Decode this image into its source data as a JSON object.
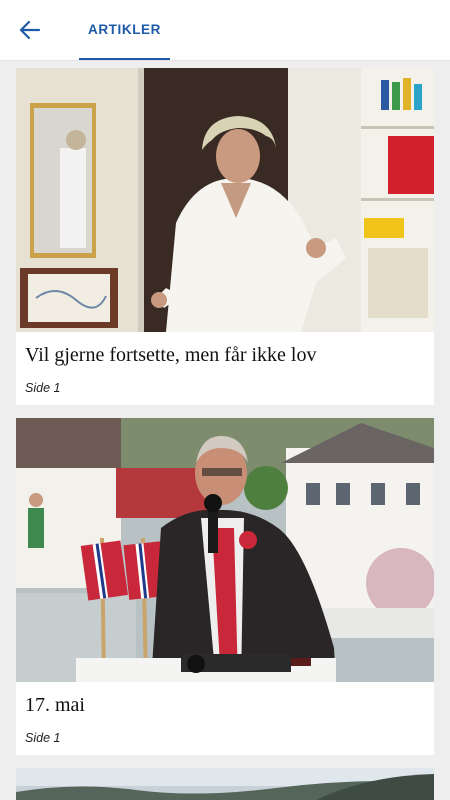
{
  "appbar": {
    "back_icon": "arrow-left-icon",
    "tab_label": "ARTIKLER",
    "accent_color": "#1c5aa8"
  },
  "articles": [
    {
      "title": "Vil gjerne fortsette, men får ikke lov",
      "page": "Side 1"
    },
    {
      "title": "17. mai",
      "page": "Side 1"
    }
  ]
}
